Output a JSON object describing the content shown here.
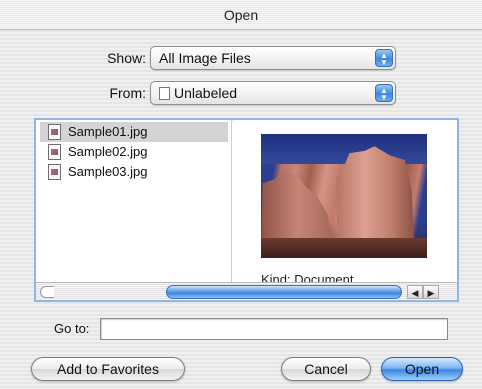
{
  "window": {
    "title": "Open"
  },
  "show": {
    "label": "Show:",
    "value": "All Image Files"
  },
  "from": {
    "label": "From:",
    "value": "Unlabeled"
  },
  "files": [
    {
      "name": "Sample01.jpg",
      "selected": true
    },
    {
      "name": "Sample02.jpg",
      "selected": false
    },
    {
      "name": "Sample03.jpg",
      "selected": false
    }
  ],
  "preview": {
    "kind_text": "Kind: Document"
  },
  "goto": {
    "label": "Go to:",
    "value": ""
  },
  "buttons": {
    "add_favorites": "Add to Favorites",
    "cancel": "Cancel",
    "open": "Open"
  },
  "icons": {
    "popup_arrows": "updown-arrows-icon",
    "volume": "volume-icon",
    "file": "jpeg-file-icon",
    "scroll_left": "scroll-left-arrow-icon",
    "scroll_right": "scroll-right-arrow-icon"
  },
  "colors": {
    "accent": "#3a86e0",
    "selection": "#d4d4d4"
  }
}
